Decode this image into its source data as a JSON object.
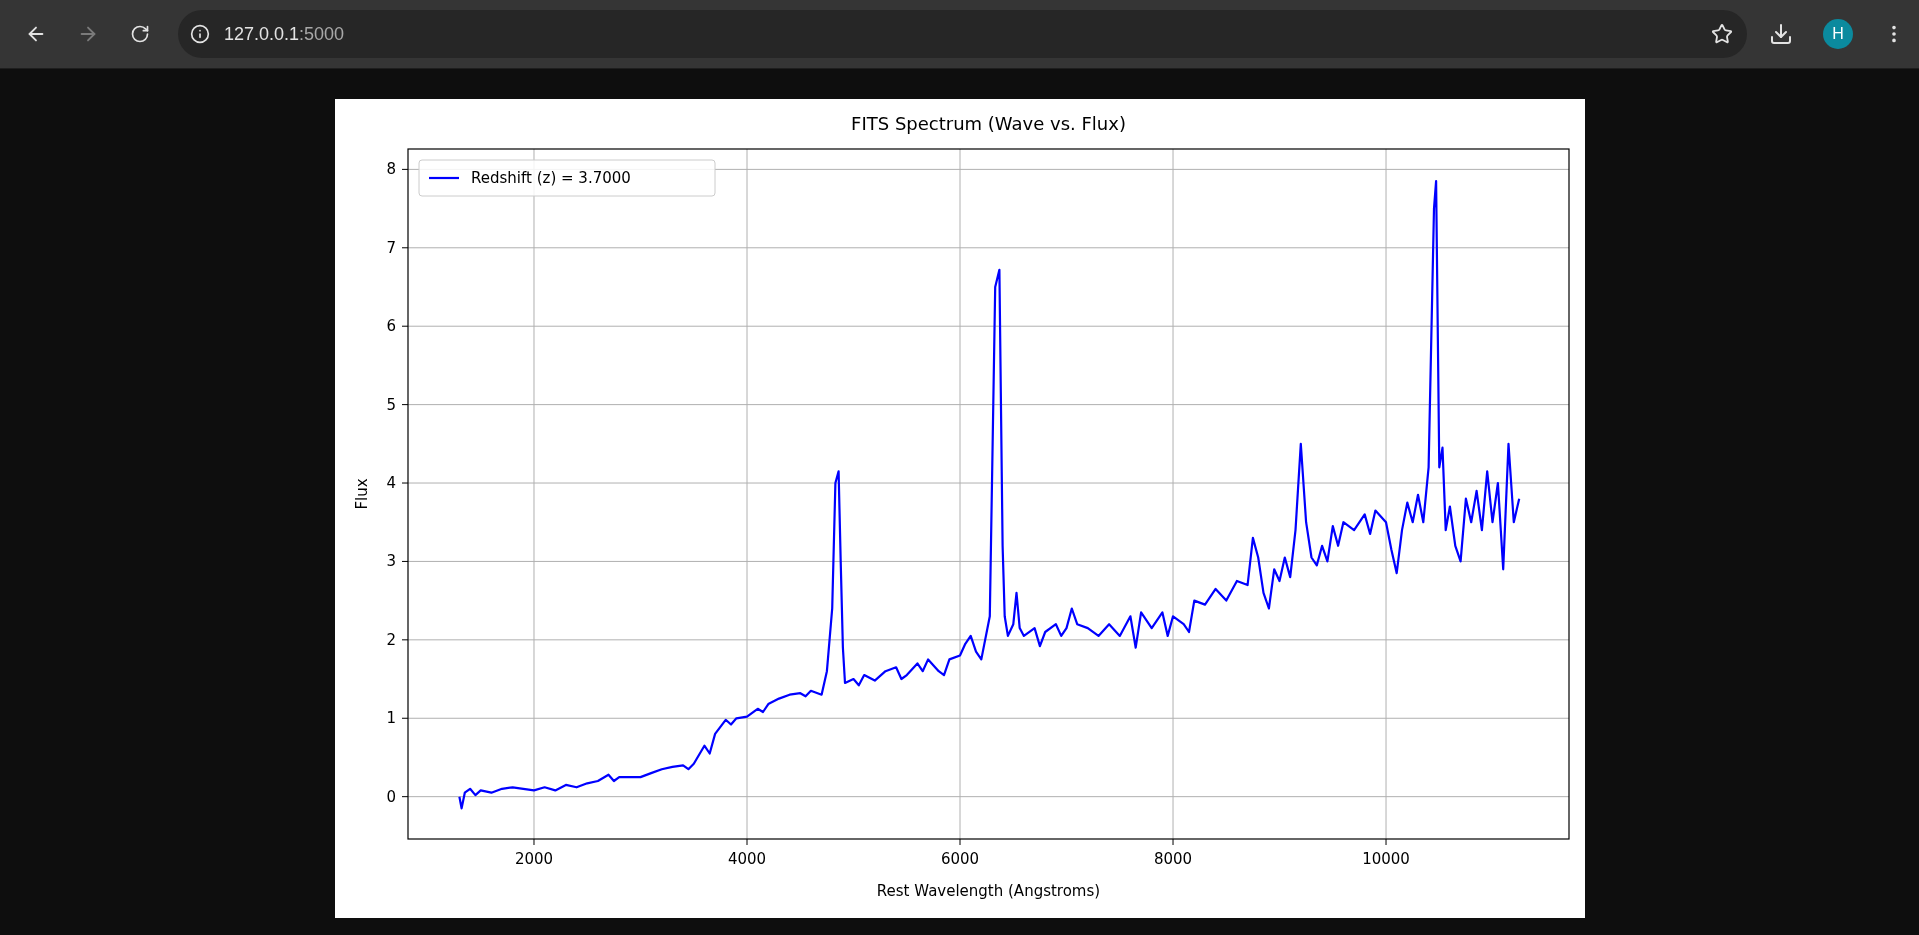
{
  "browser": {
    "back_disabled": false,
    "forward_disabled": true,
    "url_host": "127.0.0.1",
    "url_port": ":5000",
    "profile_initial": "H"
  },
  "figure": {
    "chart_data": {
      "type": "line",
      "title": "FITS Spectrum (Wave vs. Flux)",
      "xlabel": "Rest Wavelength (Angstroms)",
      "ylabel": "Flux",
      "x": [
        1300,
        1320,
        1350,
        1400,
        1450,
        1500,
        1600,
        1700,
        1800,
        1900,
        2000,
        2100,
        2200,
        2300,
        2400,
        2500,
        2600,
        2700,
        2750,
        2800,
        3000,
        3100,
        3200,
        3300,
        3400,
        3450,
        3500,
        3600,
        3650,
        3700,
        3800,
        3850,
        3900,
        4000,
        4100,
        4150,
        4200,
        4300,
        4400,
        4500,
        4550,
        4600,
        4700,
        4750,
        4800,
        4830,
        4860,
        4880,
        4900,
        4920,
        5000,
        5050,
        5100,
        5200,
        5300,
        5400,
        5450,
        5500,
        5600,
        5650,
        5700,
        5800,
        5850,
        5900,
        6000,
        6050,
        6100,
        6150,
        6200,
        6280,
        6330,
        6370,
        6400,
        6420,
        6450,
        6500,
        6530,
        6560,
        6600,
        6700,
        6750,
        6800,
        6900,
        6950,
        7000,
        7050,
        7100,
        7200,
        7300,
        7400,
        7500,
        7600,
        7650,
        7700,
        7800,
        7900,
        7950,
        8000,
        8100,
        8150,
        8200,
        8300,
        8400,
        8500,
        8600,
        8700,
        8750,
        8800,
        8850,
        8900,
        8950,
        9000,
        9050,
        9100,
        9150,
        9200,
        9250,
        9300,
        9350,
        9400,
        9450,
        9500,
        9550,
        9600,
        9700,
        9800,
        9850,
        9900,
        10000,
        10050,
        10100,
        10150,
        10200,
        10250,
        10300,
        10350,
        10400,
        10450,
        10470,
        10500,
        10530,
        10560,
        10600,
        10650,
        10700,
        10750,
        10800,
        10850,
        10900,
        10950,
        11000,
        11050,
        11100,
        11150,
        11200,
        11250
      ],
      "series": [
        {
          "name": "Redshift (z) = 3.7000",
          "color": "#0000ff",
          "values": [
            0,
            -0.15,
            0.05,
            0.1,
            0.02,
            0.08,
            0.05,
            0.1,
            0.12,
            0.1,
            0.08,
            0.12,
            0.08,
            0.15,
            0.12,
            0.17,
            0.2,
            0.28,
            0.2,
            0.25,
            0.25,
            0.3,
            0.35,
            0.38,
            0.4,
            0.35,
            0.42,
            0.65,
            0.55,
            0.8,
            0.98,
            0.92,
            1.0,
            1.02,
            1.12,
            1.08,
            1.18,
            1.25,
            1.3,
            1.32,
            1.28,
            1.35,
            1.3,
            1.6,
            2.4,
            4.0,
            4.15,
            3.0,
            1.9,
            1.45,
            1.5,
            1.42,
            1.55,
            1.48,
            1.6,
            1.65,
            1.5,
            1.55,
            1.7,
            1.6,
            1.75,
            1.6,
            1.55,
            1.75,
            1.8,
            1.95,
            2.05,
            1.85,
            1.75,
            2.3,
            6.5,
            6.72,
            3.2,
            2.3,
            2.05,
            2.2,
            2.6,
            2.15,
            2.05,
            2.15,
            1.92,
            2.1,
            2.2,
            2.05,
            2.15,
            2.4,
            2.2,
            2.15,
            2.05,
            2.2,
            2.05,
            2.3,
            1.9,
            2.35,
            2.15,
            2.35,
            2.05,
            2.3,
            2.2,
            2.1,
            2.5,
            2.45,
            2.65,
            2.5,
            2.75,
            2.7,
            3.3,
            3.05,
            2.6,
            2.4,
            2.9,
            2.75,
            3.05,
            2.8,
            3.4,
            4.5,
            3.5,
            3.05,
            2.95,
            3.2,
            3.0,
            3.45,
            3.2,
            3.5,
            3.4,
            3.6,
            3.35,
            3.65,
            3.5,
            3.15,
            2.85,
            3.4,
            3.75,
            3.5,
            3.85,
            3.5,
            4.2,
            7.5,
            7.85,
            4.2,
            4.45,
            3.4,
            3.7,
            3.2,
            3.0,
            3.8,
            3.5,
            3.9,
            3.4,
            4.15,
            3.5,
            4.0,
            2.9,
            4.5,
            3.5,
            3.8
          ]
        }
      ],
      "xlim": [
        817,
        11718
      ],
      "ylim": [
        -0.54,
        8.26
      ],
      "xticks": [
        2000,
        4000,
        6000,
        8000,
        10000
      ],
      "yticks": [
        0,
        1,
        2,
        3,
        4,
        5,
        6,
        7,
        8
      ],
      "grid": true
    }
  }
}
